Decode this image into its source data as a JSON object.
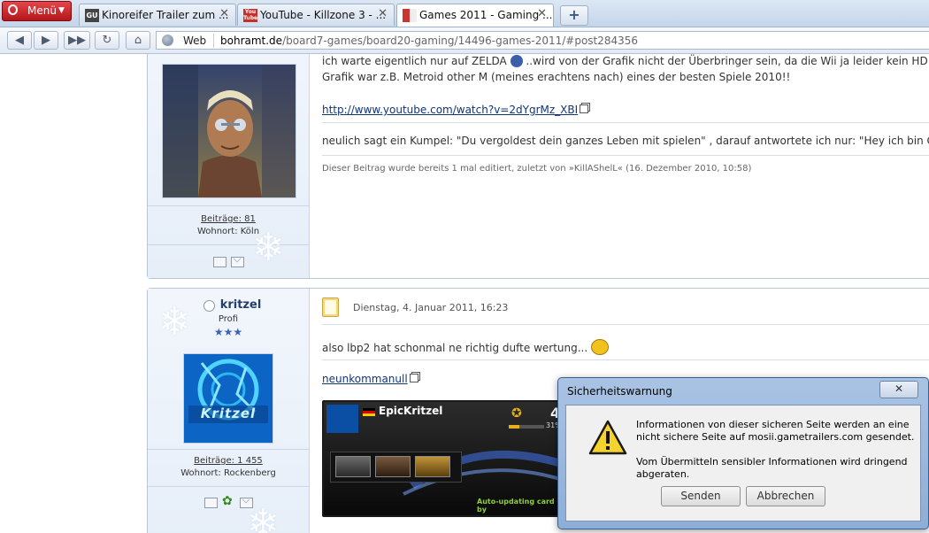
{
  "browser": {
    "menu_label": "Menü",
    "tabs": [
      {
        "title": "Kinoreifer Trailer zum ...",
        "favicon": "GU"
      },
      {
        "title": "YouTube - Killzone 3 - ...",
        "favicon": "You Tube"
      },
      {
        "title": "Games 2011 - Gaming ...",
        "favicon": "forum"
      }
    ],
    "new_tab_label": "+",
    "address": {
      "scheme_label": "Web",
      "host": "bohramt.de",
      "path": "/board7-games/board20-gaming/14496-games-2011/#post284356"
    }
  },
  "post1": {
    "line1": "ich warte eigentlich nur auf ZELDA",
    "line1_after": "..wird von der Grafik nicht der Überbringer sein, da die Wii ja leider kein HD a",
    "line2": "Grafik war z.B. Metroid other M (meines erachtens nach) eines der besten Spiele 2010!!",
    "link": "http://www.youtube.com/watch?v=2dYgrMz_XBI",
    "line3": "neulich sagt ein Kumpel: \"Du vergoldest dein ganzes Leben mit spielen\" , darauf antwortete ich nur: \"Hey ich bin Gam",
    "edit_note": "Dieser Beitrag wurde bereits 1 mal editiert, zuletzt von »KillAShelL« (16. Dezember 2010, 10:58)",
    "author": {
      "posts": "Beiträge: 81",
      "location": "Wohnort: Köln"
    }
  },
  "post2": {
    "author": {
      "name": "kritzel",
      "rank": "Profi",
      "stars": "★★★",
      "posts": "Beiträge: 1 455",
      "location": "Wohnort: Rockenberg",
      "avatar_text": "Kritzel"
    },
    "date": "Dienstag, 4. Januar 2011, 16:23",
    "text": "also lbp2 hat schonmal ne richtig dufte wertung...",
    "signature_link": "neunkommanull",
    "psn_card": {
      "name": "EpicKritzel",
      "level": "4",
      "progress": "31%",
      "footer": "Auto-updating card by"
    }
  },
  "dialog": {
    "title": "Sicherheitswarnung",
    "close": "✕",
    "message1_line1": "Informationen von dieser sicheren Seite werden an eine",
    "message1_line2": "nicht sichere Seite auf mosii.gametrailers.com gesendet.",
    "message2_line1": "Vom Übermitteln sensibler Informationen wird dringend",
    "message2_line2": "abgeraten.",
    "send_button": "Senden",
    "cancel_button": "Abbrechen"
  }
}
